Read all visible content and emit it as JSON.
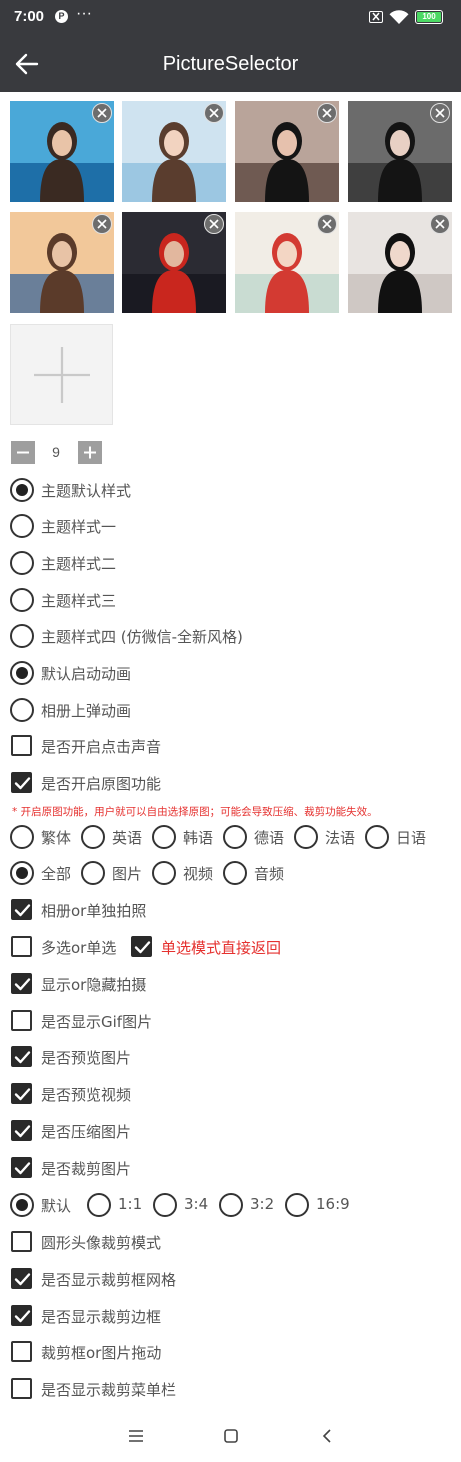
{
  "status_bar": {
    "time": "7:00",
    "app_icon": "P",
    "more": "···",
    "battery": "100"
  },
  "toolbar": {
    "title": "PictureSelector"
  },
  "photos": [
    {
      "sky": "#4aa8d8",
      "ground": "#1e6fa8",
      "figure": "#3a2a22",
      "skin": "#e9c4a8"
    },
    {
      "sky": "#cfe3f0",
      "ground": "#9cc7e2",
      "figure": "#5a3d2e",
      "skin": "#f2d3c0"
    },
    {
      "sky": "#b9a49a",
      "ground": "#6f5a52",
      "figure": "#141414",
      "skin": "#e6c1ad"
    },
    {
      "sky": "#6b6b6b",
      "ground": "#3f3f3f",
      "figure": "#141414",
      "skin": "#e8d0c4"
    },
    {
      "sky": "#f2c89a",
      "ground": "#6a7f99",
      "figure": "#5b3b2a",
      "skin": "#e8c3a6"
    },
    {
      "sky": "#2b2b33",
      "ground": "#1a1a22",
      "figure": "#c9261e",
      "skin": "#e2b79e"
    },
    {
      "sky": "#f1ede6",
      "ground": "#c9dcd2",
      "figure": "#d33a32",
      "skin": "#f3d6c4"
    },
    {
      "sky": "#e8e4e1",
      "ground": "#cfc8c4",
      "figure": "#111111",
      "skin": "#efd8cc"
    }
  ],
  "stepper": {
    "value": "9"
  },
  "theme_options": [
    {
      "label": "主题默认样式",
      "checked": true
    },
    {
      "label": "主题样式一",
      "checked": false
    },
    {
      "label": "主题样式二",
      "checked": false
    },
    {
      "label": "主题样式三",
      "checked": false
    },
    {
      "label": "主题样式四 (仿微信-全新风格)",
      "checked": false
    }
  ],
  "animation_options": [
    {
      "label": "默认启动动画",
      "checked": true
    },
    {
      "label": "相册上弹动画",
      "checked": false
    }
  ],
  "toggles_a": [
    {
      "label": "是否开启点击声音",
      "checked": false
    },
    {
      "label": "是否开启原图功能",
      "checked": true
    }
  ],
  "original_note": "* 开启原图功能，用户就可以自由选择原图；可能会导致压缩、裁剪功能失效。",
  "languages": [
    {
      "label": "繁体",
      "checked": false
    },
    {
      "label": "英语",
      "checked": false
    },
    {
      "label": "韩语",
      "checked": false
    },
    {
      "label": "德语",
      "checked": false
    },
    {
      "label": "法语",
      "checked": false
    },
    {
      "label": "日语",
      "checked": false
    }
  ],
  "media_types": [
    {
      "label": "全部",
      "checked": true
    },
    {
      "label": "图片",
      "checked": false
    },
    {
      "label": "视频",
      "checked": false
    },
    {
      "label": "音频",
      "checked": false
    }
  ],
  "camera_toggle": {
    "label": "相册or单独拍照",
    "checked": true
  },
  "select_mode": {
    "label": "多选or单选",
    "checked": false
  },
  "single_return": {
    "label": "单选模式直接返回",
    "checked": true
  },
  "toggles_b": [
    {
      "label": "显示or隐藏拍摄",
      "checked": true
    },
    {
      "label": "是否显示Gif图片",
      "checked": false
    },
    {
      "label": "是否预览图片",
      "checked": true
    },
    {
      "label": "是否预览视频",
      "checked": true
    },
    {
      "label": "是否压缩图片",
      "checked": true
    },
    {
      "label": "是否裁剪图片",
      "checked": true
    }
  ],
  "crop_ratios": [
    {
      "label": "默认",
      "checked": true
    },
    {
      "label": "1:1",
      "checked": false
    },
    {
      "label": "3:4",
      "checked": false
    },
    {
      "label": "3:2",
      "checked": false
    },
    {
      "label": "16:9",
      "checked": false
    }
  ],
  "toggles_c": [
    {
      "label": "圆形头像裁剪模式",
      "checked": false
    },
    {
      "label": "是否显示裁剪框网格",
      "checked": true
    },
    {
      "label": "是否显示裁剪边框",
      "checked": true
    },
    {
      "label": "裁剪框or图片拖动",
      "checked": false
    },
    {
      "label": "是否显示裁剪菜单栏",
      "checked": false
    }
  ],
  "colors": {
    "bar": "#393a3e",
    "accent_red": "#e5312f",
    "control": "#2a2a2a"
  }
}
